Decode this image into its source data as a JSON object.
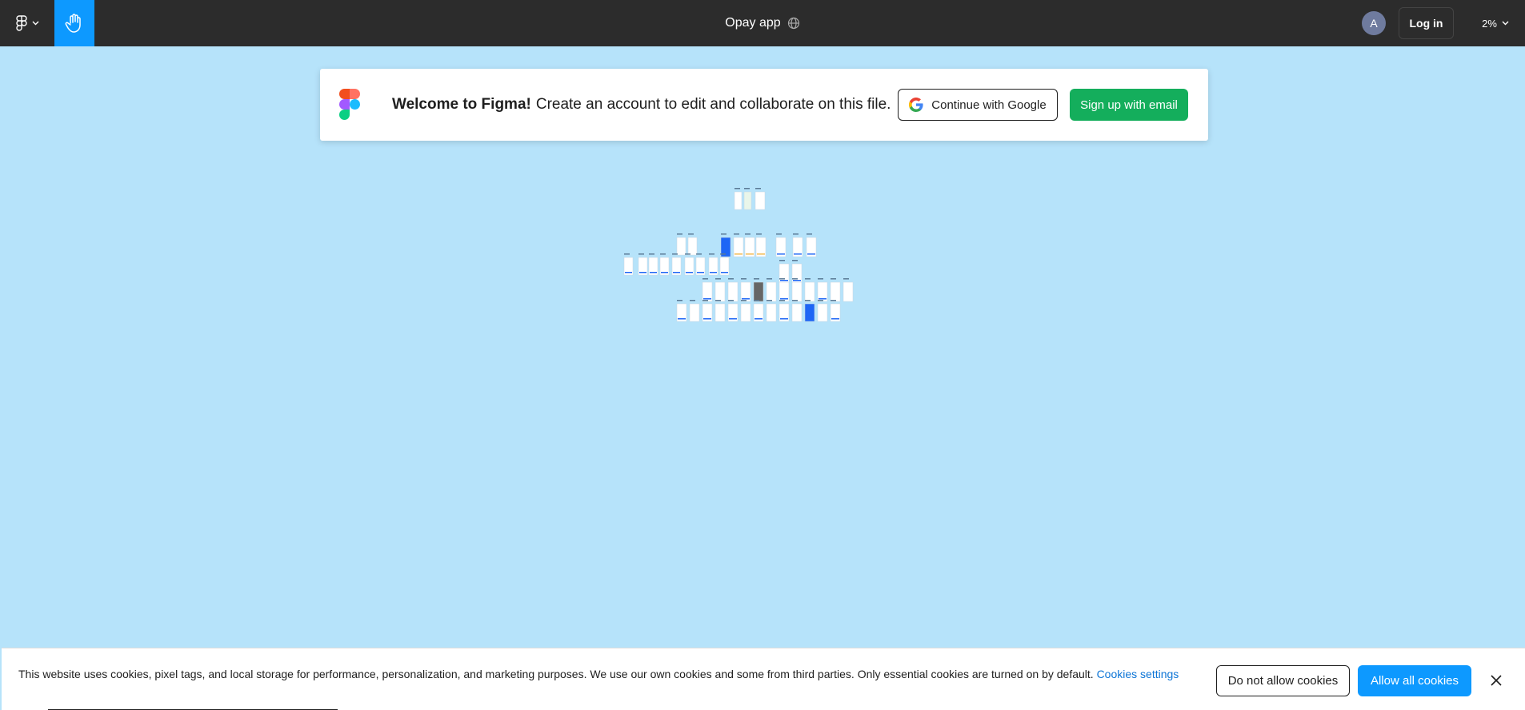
{
  "toolbar": {
    "file_title": "Opay app",
    "avatar_initial": "A",
    "login_label": "Log in",
    "zoom_level": "2%"
  },
  "banner": {
    "welcome_bold": "Welcome to Figma!",
    "welcome_rest": "Create an account to edit and collaborate on this file.",
    "google_label": "Continue with Google",
    "email_label": "Sign up with email"
  },
  "cookie_banner": {
    "text": "This website uses cookies, pixel tags, and local storage for performance, personalization, and marketing purposes. We use our own cookies and some from third parties. Only essential cookies are turned on by default.",
    "settings_link": "Cookies settings",
    "deny_label": "Do not allow cookies",
    "allow_label": "Allow all cookies"
  },
  "colors": {
    "canvas_bg": "#b6e3fa",
    "toolbar_bg": "#2c2c2c",
    "accent_blue": "#0d99ff",
    "signup_green": "#14ae5c"
  },
  "icons": {
    "main_menu": "figma-logo-icon",
    "hand_tool": "hand-icon",
    "visibility": "globe-icon",
    "close": "close-icon",
    "google": "google-g-icon"
  }
}
